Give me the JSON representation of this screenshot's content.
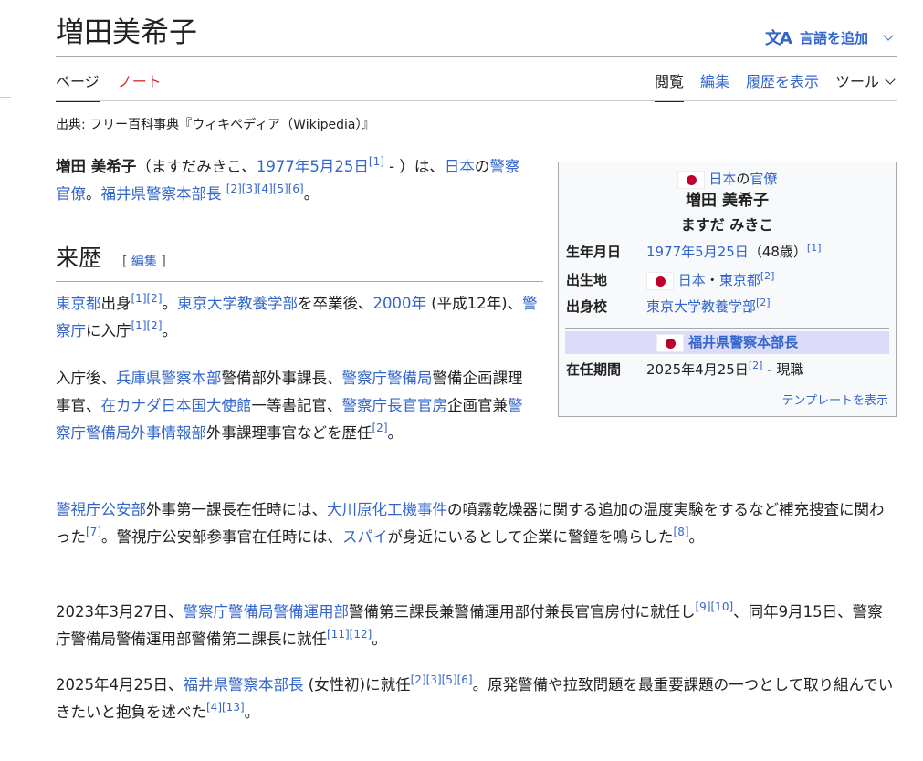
{
  "header": {
    "title": "増田美希子",
    "lang_label": "言語を追加",
    "lang_icon": "translate-icon"
  },
  "tabs": {
    "left": [
      {
        "label": "ページ",
        "selected": true
      },
      {
        "label": "ノート",
        "selected": false
      }
    ],
    "right": [
      {
        "label": "閲覧",
        "selected": true
      },
      {
        "label": "編集"
      },
      {
        "label": "履歴を表示"
      },
      {
        "label": "ツール"
      }
    ]
  },
  "tagline": "出典: フリー百科事典『ウィキペディア（Wikipedia）』",
  "intro": {
    "bold": "増田 美希子",
    "t1": "（ますだみきこ、",
    "date_link": "1977年5月25日",
    "ref1": "[1]",
    "t2": " - ）は、",
    "link_japan": "日本",
    "t3": "の",
    "link_officer": "警察官僚",
    "t4": "。",
    "link_fukui": "福井県警察本部長",
    "refs": "[2][3][4][5][6]",
    "t5": "。"
  },
  "section": {
    "heading": "来歴",
    "edit_open": "[ ",
    "edit_label": "編集",
    "edit_close": " ]"
  },
  "p2": {
    "l1": "東京都",
    "t1": "出身",
    "r1": "[1][2]",
    "t2": "。",
    "l2": "東京大学教養学部",
    "t3": "を卒業後、",
    "l3": "2000年",
    "t4": " (平成12年)、",
    "l4": "警察庁",
    "t5": "に入庁",
    "r2": "[1][2]",
    "t6": "。"
  },
  "p3": {
    "t1": "入庁後、",
    "l1": "兵庫県警察本部",
    "t2": "警備部外事課長、",
    "l2": "警察庁警備局",
    "t3": "警備企画課理事官、",
    "l3": "在カナダ日本国大使館",
    "t4": "一等書記官、",
    "l4": "警察庁長官官房",
    "t5": "企画官兼",
    "l5": "警察庁警備局外事情報部",
    "t6": "外事課理事官などを歴任",
    "r1": "[2]",
    "t7": "。"
  },
  "p4": {
    "l1": "警視庁公安部",
    "t1": "外事第一課長在任時には、",
    "l2": "大川原化工機事件",
    "t2": "の噴霧乾燥器に関する追加の温度実験をするなど補充捜査に関わった",
    "r1": "[7]",
    "t3": "。警視庁公安部参事官在任時には、",
    "l3": "スパイ",
    "t4": "が身近にいるとして企業に警鐘を鳴らした",
    "r2": "[8]",
    "t5": "。"
  },
  "p5": {
    "t1": "2023年3月27日、",
    "l1": "警察庁警備局警備運用部",
    "t2": "警備第三課長兼警備運用部付兼長官官房付に就任し",
    "r1": "[9][10]",
    "t3": "、同年9月15日、警察庁警備局警備運用部警備第二課長に就任",
    "r2": "[11][12]",
    "t4": "。"
  },
  "p6": {
    "t1": "2025年4月25日、",
    "l1": "福井県警察本部長",
    "t2": " (女性初)に就任",
    "r1": "[2][3][5][6]",
    "t3": "。原発警備や拉致問題を最重要課題の一つとして取り組んでいきたいと抱負を述べた",
    "r2": "[4][13]",
    "t4": "。"
  },
  "infobox": {
    "head_link1": "日本",
    "head_mid": "の",
    "head_link2": "官僚",
    "name": "増田 美希子",
    "kana": "ますだ みきこ",
    "birth_label": "生年月日",
    "birth_link": "1977年5月25日",
    "birth_age": "（48歳）",
    "birth_ref": "[1]",
    "place_label": "出生地",
    "place_link1": "日本",
    "place_sep": "・",
    "place_link2": "東京都",
    "place_ref": "[2]",
    "school_label": "出身校",
    "school_link": "東京大学教養学部",
    "school_ref": "[2]",
    "section_link": "福井県警察本部長",
    "term_label": "在任期間",
    "term_value": "2025年4月25日",
    "term_ref": "[2]",
    "term_end": " - 現職",
    "template_link": "テンプレートを表示"
  },
  "colors": {
    "link": "#3366cc",
    "visited": "#795cb2",
    "red_link": "#d73333",
    "infobox_section_bg": "#dcdcfa",
    "flag_red": "#bc002d"
  }
}
